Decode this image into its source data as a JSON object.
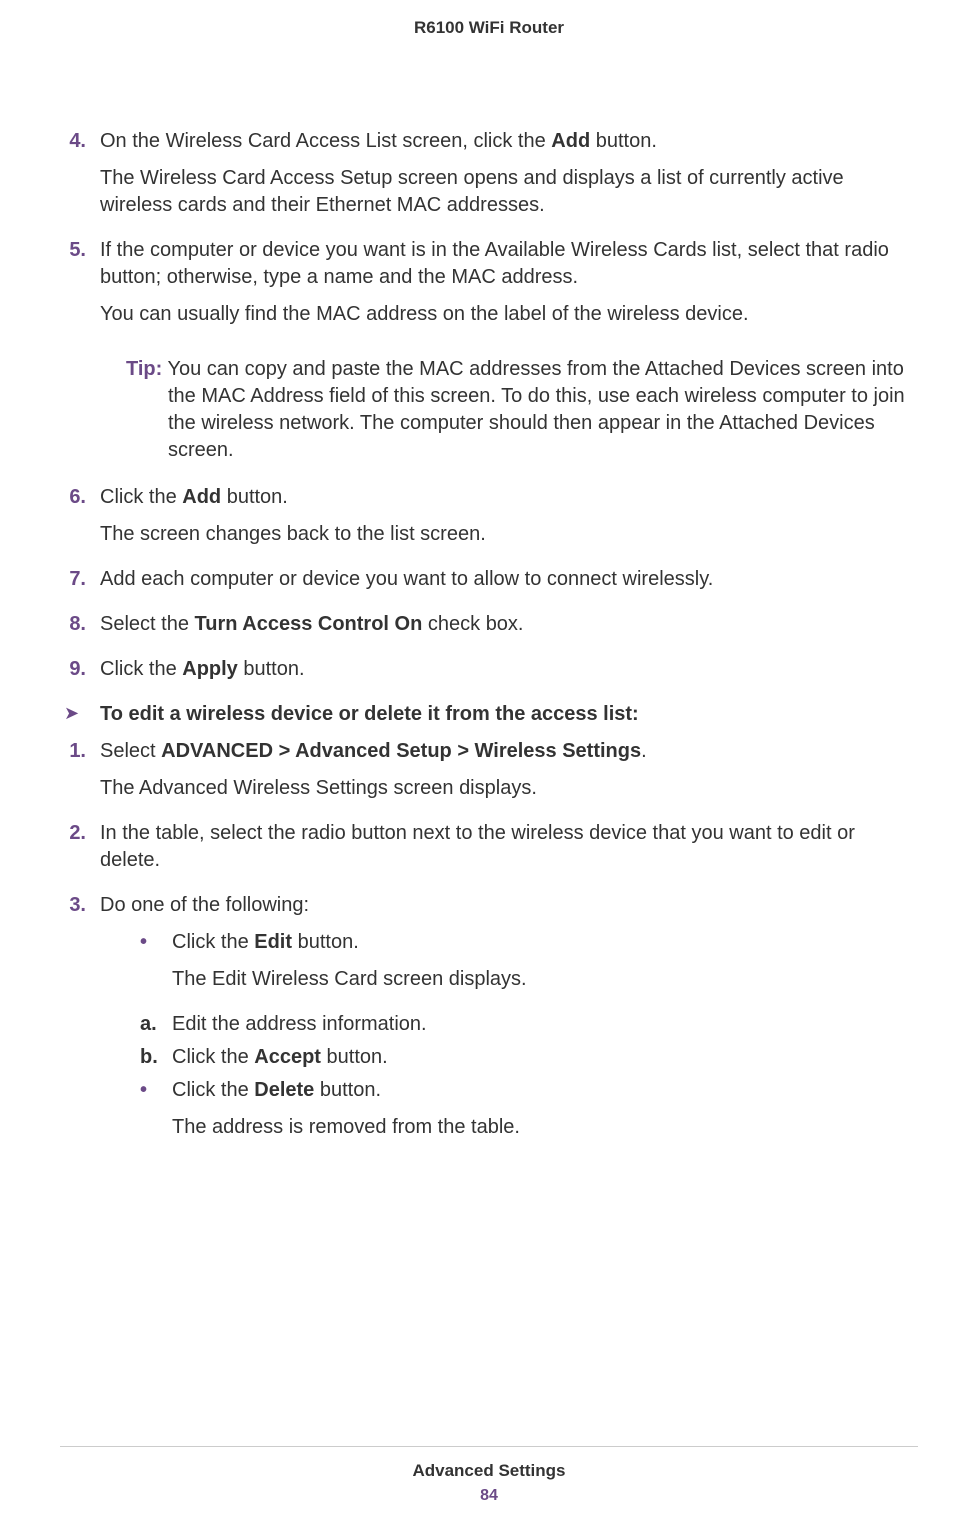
{
  "header": "R6100 WiFi Router",
  "steps": {
    "s4": {
      "num": "4.",
      "p1a": "On the Wireless Card Access List screen, click the ",
      "p1b": "Add",
      "p1c": " button.",
      "p2": "The Wireless Card Access Setup screen opens and displays a list of currently active wireless cards and their Ethernet MAC addresses."
    },
    "s5": {
      "num": "5.",
      "p1": "If the computer or device you want is in the Available Wireless Cards list, select that radio button; otherwise, type a name and the MAC address.",
      "p2": "You can usually find the MAC address on the label of the wireless device."
    },
    "tip": {
      "label": "Tip:",
      "text": " You can copy and paste the MAC addresses from the Attached Devices screen into the MAC Address field of this screen. To do this, use each wireless computer to join the wireless network. The computer should then appear in the Attached Devices screen."
    },
    "s6": {
      "num": "6.",
      "p1a": "Click the ",
      "p1b": "Add",
      "p1c": " button.",
      "p2": "The screen changes back to the list screen."
    },
    "s7": {
      "num": "7.",
      "p1": "Add each computer or device you want to allow to connect wirelessly."
    },
    "s8": {
      "num": "8.",
      "p1a": "Select the ",
      "p1b": "Turn Access Control On",
      "p1c": " check box."
    },
    "s9": {
      "num": "9.",
      "p1a": "Click the ",
      "p1b": "Apply",
      "p1c": " button."
    },
    "proc2": {
      "title": "To edit a wireless device or delete it from the access list:"
    },
    "e1": {
      "num": "1.",
      "p1a": "Select ",
      "p1b": "ADVANCED > Advanced Setup > Wireless Settings",
      "p1c": ".",
      "p2": "The Advanced Wireless Settings screen displays."
    },
    "e2": {
      "num": "2.",
      "p1": "In the table, select the radio button next to the wireless device that you want to edit or delete."
    },
    "e3": {
      "num": "3.",
      "p1": "Do one of the following:"
    },
    "b1": {
      "p1a": "Click the ",
      "p1b": "Edit",
      "p1c": " button.",
      "p2": "The Edit Wireless Card screen displays."
    },
    "sa": {
      "num": "a.",
      "p1": "Edit the address information."
    },
    "sb": {
      "num": "b.",
      "p1a": "Click the ",
      "p1b": "Accept",
      "p1c": " button."
    },
    "b2": {
      "p1a": "Click the ",
      "p1b": "Delete",
      "p1c": " button.",
      "p2": "The address is removed from the table."
    }
  },
  "footer": {
    "title": "Advanced Settings",
    "page": "84"
  },
  "glyphs": {
    "bullet": "•",
    "arrow": "➤"
  }
}
